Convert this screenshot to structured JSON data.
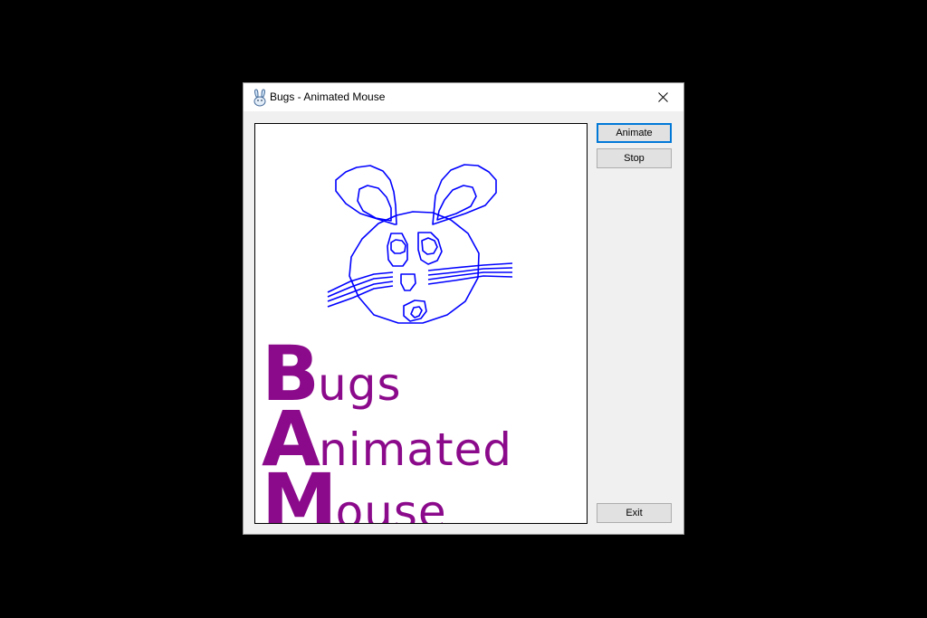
{
  "window": {
    "title": "Bugs - Animated Mouse",
    "icon": "bunny-icon",
    "close_icon": "close-icon"
  },
  "buttons": {
    "animate": "Animate",
    "stop": "Stop",
    "exit": "Exit"
  },
  "canvas": {
    "drawing": "mouse-face-drawing",
    "drawing_color": "#0000ff",
    "text_color": "#8b0a8b",
    "lines": [
      {
        "initial": "B",
        "rest": "ugs"
      },
      {
        "initial": "A",
        "rest": "nimated"
      },
      {
        "initial": "M",
        "rest": "ouse"
      }
    ]
  }
}
